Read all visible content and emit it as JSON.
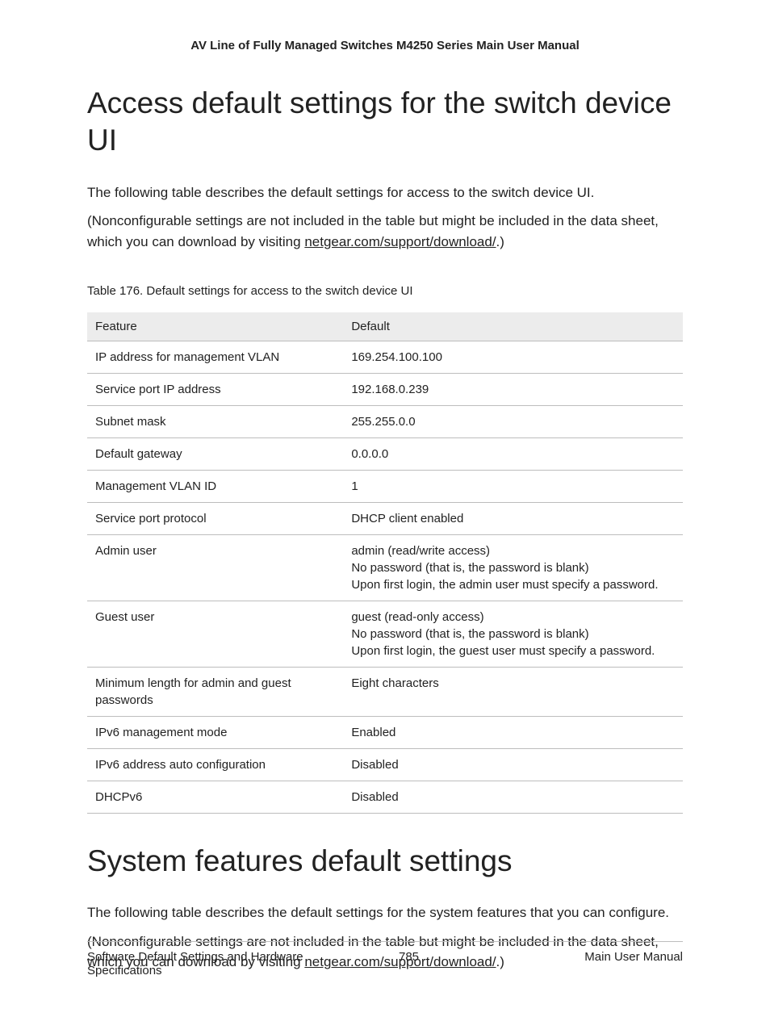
{
  "header": {
    "running_title": "AV Line of Fully Managed Switches M4250 Series Main User Manual"
  },
  "section1": {
    "title": "Access default settings for the switch device UI",
    "para1": "The following table describes the default settings for access to the switch device UI.",
    "para2_pre": "(Nonconfigurable settings are not included in the table but might be included in the data sheet, which you can download by visiting ",
    "para2_link": "netgear.com/support/download/",
    "para2_post": ".)",
    "table_caption": "Table 176. Default settings for access to the switch device UI",
    "col_feature": "Feature",
    "col_default": "Default",
    "rows": [
      {
        "feature": "IP address for management VLAN",
        "default": [
          "169.254.100.100"
        ]
      },
      {
        "feature": "Service port IP address",
        "default": [
          "192.168.0.239"
        ]
      },
      {
        "feature": "Subnet mask",
        "default": [
          "255.255.0.0"
        ]
      },
      {
        "feature": "Default gateway",
        "default": [
          "0.0.0.0"
        ]
      },
      {
        "feature": "Management VLAN ID",
        "default": [
          "1"
        ]
      },
      {
        "feature": "Service port protocol",
        "default": [
          "DHCP client enabled"
        ]
      },
      {
        "feature": "Admin user",
        "default": [
          "admin (read/write access)",
          "No password (that is, the password is blank)",
          "Upon first login, the admin user must specify a password."
        ]
      },
      {
        "feature": "Guest user",
        "default": [
          "guest (read-only access)",
          "No password (that is, the password is blank)",
          "Upon first login, the guest user must specify a password."
        ]
      },
      {
        "feature": "Minimum length for admin and guest passwords",
        "default": [
          "Eight characters"
        ]
      },
      {
        "feature": "IPv6 management mode",
        "default": [
          "Enabled"
        ]
      },
      {
        "feature": "IPv6 address auto configuration",
        "default": [
          "Disabled"
        ]
      },
      {
        "feature": "DHCPv6",
        "default": [
          "Disabled"
        ]
      }
    ]
  },
  "section2": {
    "title": "System features default settings",
    "para1": "The following table describes the default settings for the system features that you can configure.",
    "para2_pre": "(Nonconfigurable settings are not included in the table but might be included in the data sheet, which you can download by visiting ",
    "para2_link": "netgear.com/support/download/",
    "para2_post": ".)"
  },
  "footer": {
    "left": "Software Default Settings and Hardware Specifications",
    "page_number": "785",
    "right": "Main User Manual"
  }
}
